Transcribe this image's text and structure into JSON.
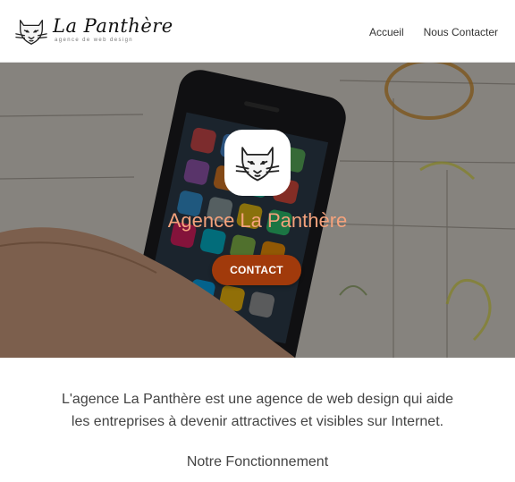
{
  "brand": {
    "name": "La Panthère",
    "tagline": "agence de web design",
    "logo_icon": "panther-head-icon"
  },
  "nav": {
    "items": [
      "Accueil",
      "Nous Contacter"
    ]
  },
  "hero": {
    "title": "Agence La Panthère",
    "button_label": "CONTACT",
    "badge_icon": "panther-head-icon"
  },
  "intro": {
    "lines": [
      "L'agence La Panthère est une agence de web design qui aide",
      "les entreprises à devenir attractives et visibles sur Internet."
    ]
  },
  "section": {
    "title": "Notre Fonctionnement"
  },
  "colors": {
    "hero_title": "#f4a27c",
    "button_bg": "#a13a0b",
    "text": "#444444"
  }
}
